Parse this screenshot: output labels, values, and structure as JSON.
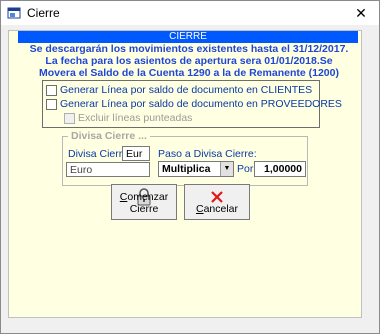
{
  "window": {
    "title": "Cierre",
    "close": "✕"
  },
  "header": {
    "title": "CIERRE"
  },
  "message": "Se descargarán los movimientos existentes hasta el 31/12/2017. La fecha para los asientos de apertura sera 01/01/2018.Se Movera el Saldo de la Cuenta 1290 a la de Remanente (1200)",
  "options": [
    {
      "label": "Generar Línea por saldo de documento en CLIENTES",
      "checked": false,
      "enabled": true
    },
    {
      "label": "Generar Línea por saldo de documento en PROVEEDORES",
      "checked": false,
      "enabled": true
    },
    {
      "label": "Excluir líneas punteadas",
      "checked": false,
      "enabled": false
    }
  ],
  "divisa_group": {
    "title": "Divisa Cierre ...",
    "divisa_label": "Divisa Cierre",
    "divisa_code": "Eur",
    "divisa_name": "Euro",
    "paso_label": "Paso a Divisa Cierre:",
    "operation": "Multiplica",
    "por_label": "Por",
    "factor": "1,00000"
  },
  "buttons": {
    "start_prefix": "",
    "start_accel": "C",
    "start_rest": "omenzar Cierre",
    "cancel_prefix": "",
    "cancel_accel": "C",
    "cancel_rest": "ancelar"
  },
  "colors": {
    "header_bg": "#0058ff",
    "content_bg": "#ffffe1",
    "message_text": "#1f47d6",
    "label_text": "#0a39a8",
    "cancel_icon": "#e01818"
  },
  "icons": {
    "start": "padlock-icon",
    "cancel": "red-x-icon"
  }
}
